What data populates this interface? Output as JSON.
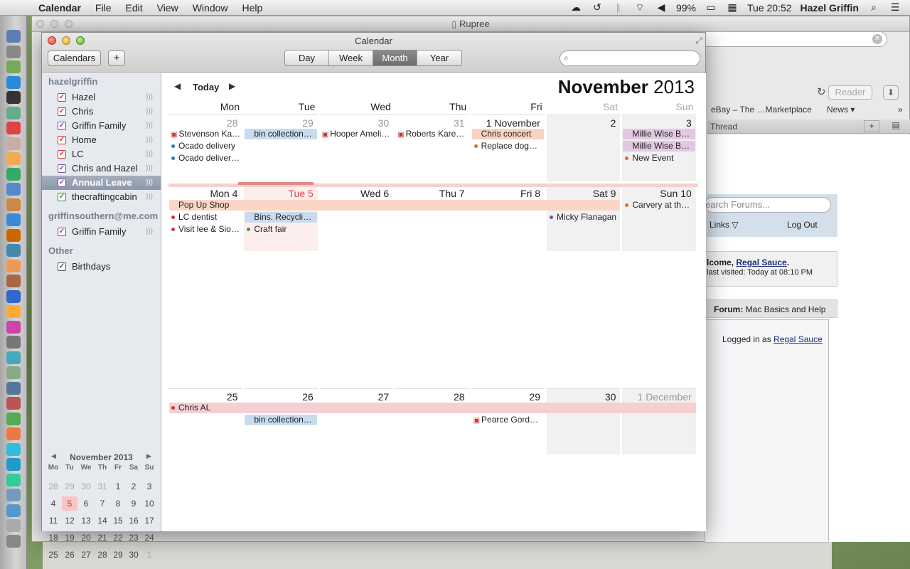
{
  "menubar": {
    "app": "Calendar",
    "items": [
      "File",
      "Edit",
      "View",
      "Window",
      "Help"
    ],
    "battery": "99%",
    "clock": "Tue 20:52",
    "user": "Hazel Griffin"
  },
  "background_window": {
    "title": "Rupree",
    "reader": "Reader",
    "bookmarks": [
      "eBay – The …Marketplace",
      "News ▾"
    ],
    "tab": "Thread",
    "search_placeholder": "earch Forums...",
    "links": "Links",
    "logout": "Log Out",
    "welcome_prefix": "lcome, ",
    "welcome_user": "Regal Sauce",
    "last_visited": "last visited: Today at 08:10 PM",
    "crumb_label": "Forum:",
    "crumb_value": "Mac Basics and Help",
    "logged_in_prefix": "Logged in as ",
    "logged_in_user": "Regal Sauce"
  },
  "calendar": {
    "window_title": "Calendar",
    "calendars_button": "Calendars",
    "add_button": "+",
    "views": [
      "Day",
      "Week",
      "Month",
      "Year"
    ],
    "active_view": "Month",
    "today_button": "Today",
    "month": "November",
    "year": "2013",
    "weekdays": [
      "Mon",
      "Tue",
      "Wed",
      "Thu",
      "Fri",
      "Sat",
      "Sun"
    ]
  },
  "sidebar": {
    "groups": [
      {
        "name": "hazelgriffin",
        "items": [
          {
            "label": "Hazel",
            "color": "#c83c3c",
            "checked": true
          },
          {
            "label": "Chris",
            "color": "#c83c3c",
            "checked": true
          },
          {
            "label": "Griffin Family",
            "color": "#7a4ea0",
            "checked": true
          },
          {
            "label": "Home",
            "color": "#c83c3c",
            "checked": true
          },
          {
            "label": "LC",
            "color": "#c83c3c",
            "checked": true
          },
          {
            "label": "Chris and Hazel",
            "color": "#7a4ea0",
            "checked": true
          },
          {
            "label": "Annual Leave",
            "color": "#7a4ea0",
            "checked": true,
            "selected": true
          },
          {
            "label": "thecraftingcabin",
            "color": "#3a8a3a",
            "checked": true
          }
        ]
      },
      {
        "name": "griffinsouthern@me.com",
        "items": [
          {
            "label": "Griffin Family",
            "color": "#7a4ea0",
            "checked": true
          }
        ]
      },
      {
        "name": "Other",
        "items": [
          {
            "label": "Birthdays",
            "color": "#555555",
            "checked": true
          }
        ]
      }
    ]
  },
  "mini_calendar": {
    "title": "November 2013",
    "dow": [
      "Mo",
      "Tu",
      "We",
      "Th",
      "Fr",
      "Sa",
      "Su"
    ],
    "weeks": [
      [
        "28",
        "29",
        "30",
        "31",
        "1",
        "2",
        "3"
      ],
      [
        "4",
        "5",
        "6",
        "7",
        "8",
        "9",
        "10"
      ],
      [
        "11",
        "12",
        "13",
        "14",
        "15",
        "16",
        "17"
      ],
      [
        "18",
        "19",
        "20",
        "21",
        "22",
        "23",
        "24"
      ],
      [
        "25",
        "26",
        "27",
        "28",
        "29",
        "30",
        "1"
      ]
    ],
    "today": "5"
  },
  "weeks": [
    {
      "days": [
        "28",
        "29",
        "30",
        "31",
        "1 November",
        "2",
        "3"
      ],
      "dim": [
        true,
        true,
        true,
        true,
        false,
        false,
        false
      ],
      "events": [
        {
          "day": 0,
          "line": 0,
          "text": "Stevenson Ka…",
          "style": "gift"
        },
        {
          "day": 0,
          "line": 1,
          "text": "Ocado delivery",
          "style": "dot",
          "color": "#2a7ac0"
        },
        {
          "day": 0,
          "line": 2,
          "text": "Ocado deliver…",
          "style": "dot",
          "color": "#2a7ac0"
        },
        {
          "day": 1,
          "line": 0,
          "text": "bin collection…",
          "style": "block",
          "bg": "#c9dcef"
        },
        {
          "day": 2,
          "line": 0,
          "text": "Hooper Ameli…",
          "style": "gift"
        },
        {
          "day": 3,
          "line": 0,
          "text": "Roberts Kare…",
          "style": "gift"
        },
        {
          "day": 4,
          "line": 0,
          "text": "Chris concert",
          "style": "block",
          "bg": "#f9d2c2"
        },
        {
          "day": 4,
          "line": 1,
          "text": "Replace dog…",
          "style": "dot",
          "color": "#e06a2a"
        },
        {
          "day": 6,
          "line": 0,
          "text": "Millie Wise B…",
          "style": "block",
          "bg": "#e3c8e3"
        },
        {
          "day": 6,
          "line": 1,
          "text": "Millie Wise B…",
          "style": "block",
          "bg": "#e3c8e3"
        },
        {
          "day": 6,
          "line": 2,
          "text": "New Event",
          "style": "dot",
          "color": "#e06a2a"
        }
      ]
    },
    {
      "days": [
        "Mon 4",
        "Tue 5",
        "Wed 6",
        "Thu 7",
        "Fri 8",
        "Sat 9",
        "Sun 10"
      ],
      "dim": [
        false,
        false,
        false,
        false,
        false,
        false,
        false
      ],
      "spans": [
        {
          "start": 0,
          "end": 5,
          "line": 0,
          "text": "Pop Up Shop",
          "bg": "#fbd6c6"
        }
      ],
      "events": [
        {
          "day": 6,
          "line": 0,
          "text": "Carvery at th…",
          "style": "dot",
          "color": "#e06a2a"
        },
        {
          "day": 0,
          "line": 1,
          "text": "LC dentist",
          "style": "dot",
          "color": "#c83c3c"
        },
        {
          "day": 0,
          "line": 2,
          "text": "Visit lee & Sio…",
          "style": "dot",
          "color": "#c83c3c"
        },
        {
          "day": 1,
          "line": 1,
          "text": "Bins. Recycli…",
          "style": "block",
          "bg": "#c9dcef"
        },
        {
          "day": 1,
          "line": 2,
          "text": "Craft fair",
          "style": "dot",
          "color": "#3a9a3a"
        },
        {
          "day": 5,
          "line": 1,
          "text": "Micky Flanagan",
          "style": "dot",
          "color": "#7a4ea0"
        }
      ]
    },
    {
      "days": [
        "25",
        "26",
        "27",
        "28",
        "29",
        "30",
        "1 December"
      ],
      "dim": [
        false,
        false,
        false,
        false,
        false,
        false,
        true
      ],
      "spans": [
        {
          "start": 0,
          "end": 6,
          "line": 0,
          "text": "Chris AL",
          "bg": "#f6cfd3",
          "dot": "#c83c3c"
        }
      ],
      "events": [
        {
          "day": 1,
          "line": 1,
          "text": "bin collection…",
          "style": "block",
          "bg": "#c9dcef"
        },
        {
          "day": 4,
          "line": 1,
          "text": "Pearce Gord…",
          "style": "gift"
        }
      ]
    }
  ]
}
